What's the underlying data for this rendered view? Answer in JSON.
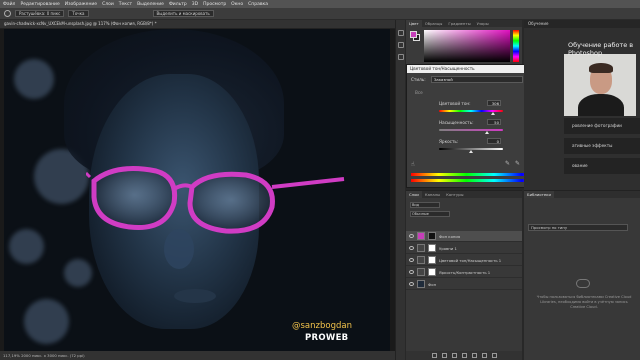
{
  "menubar": {
    "items": [
      "Файл",
      "Редактирование",
      "Изображение",
      "Слои",
      "Текст",
      "Выделение",
      "Фильтр",
      "3D",
      "Просмотр",
      "Окно",
      "Справка"
    ]
  },
  "options": {
    "feather_label": "Растушёвка: 0 пикс",
    "mode_value": "Точка",
    "search_placeholder": "Выделить и маскировать"
  },
  "document": {
    "tab_title": "gavin-chadwick-xcNv_UXCEkM-unsplash.jpg @ 117% (Фон копия, RGB/8*) *",
    "status": "117,19%   2000 пикс. х 3000 пикс. (72 ppi)"
  },
  "watermark": {
    "handle": "@sanzbogdan",
    "brand": "PROWEB"
  },
  "color_panel": {
    "tabs": [
      "Цвет",
      "Образцы",
      "Градиенты",
      "Узоры"
    ],
    "fg_color": "#c63fb9",
    "bg_color": "#222222"
  },
  "hue_sat": {
    "title": "Цветовой тон/Насыщенность",
    "preset_label": "Стиль:",
    "preset_value": "Заказной",
    "channel_value": "Все",
    "hue_label": "Цветовой тон:",
    "hue_value": "306",
    "hue_level": 0.85,
    "sat_label": "Насыщенность:",
    "sat_value": "50",
    "sat_level": 0.75,
    "light_label": "Яркость:",
    "light_value": "0",
    "light_level": 0.5,
    "colorize_label": "Тонирование",
    "colorize_checked": true,
    "preview_label": "Просмотр",
    "preview_checked": true
  },
  "learn": {
    "tab": "Обучение",
    "title": "Обучение работе в Photoshop",
    "items": [
      "Поши",
      "сновы",
      "ровление фотографии",
      "ативные эффекты",
      "ование"
    ]
  },
  "layers": {
    "tabs": [
      "Слои",
      "Каналы",
      "Контуры"
    ],
    "search_placeholder": "Вид",
    "blend_mode": "Обычные",
    "rows": [
      {
        "name": "Фон копия",
        "selected": true
      },
      {
        "name": "Уровни 1",
        "selected": false
      },
      {
        "name": "Цветовой тон/Насыщенность 1",
        "selected": false
      },
      {
        "name": "Яркость/Контрастность 1",
        "selected": false
      },
      {
        "name": "Фон",
        "selected": false
      }
    ]
  },
  "libraries": {
    "tab": "Библиотеки",
    "select": "Просмотр по типу",
    "empty_text": "Чтобы пользоваться библиотеками Creative Cloud Libraries, необходимо войти в учётную запись Creative Cloud."
  }
}
